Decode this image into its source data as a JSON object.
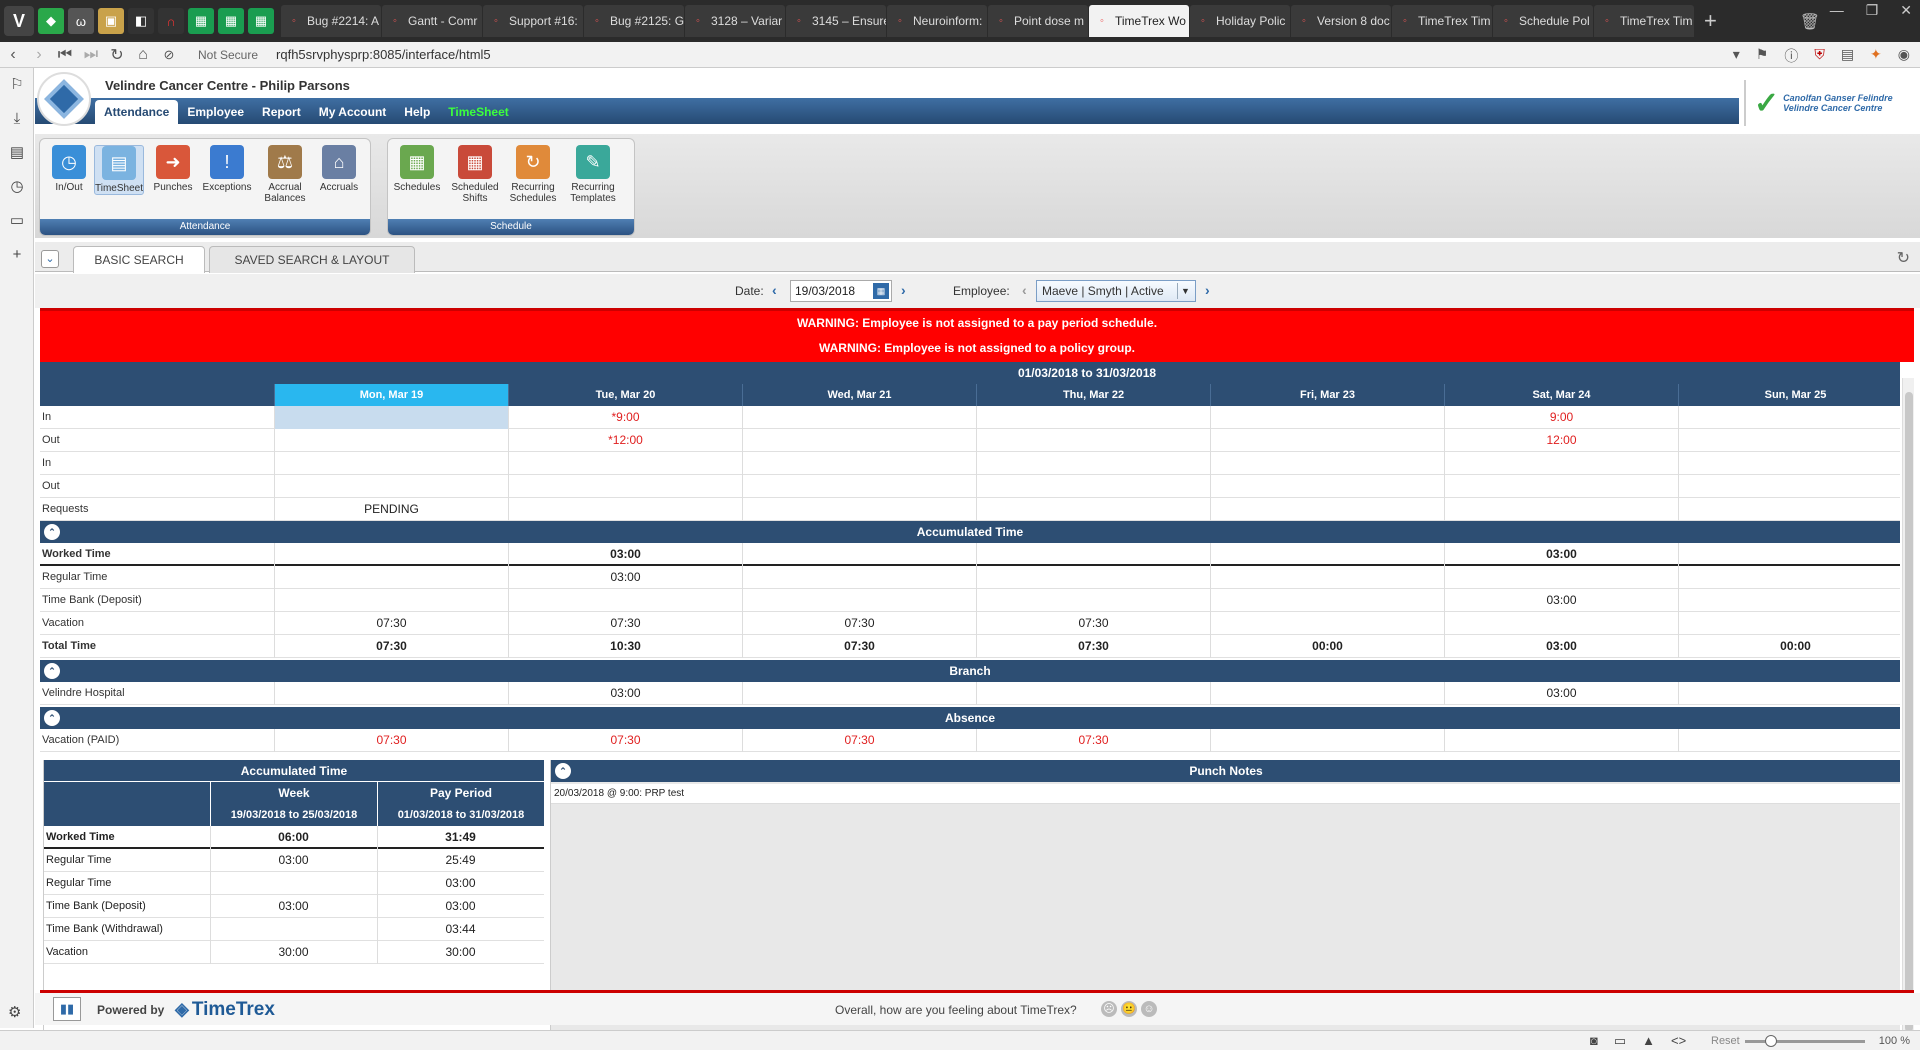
{
  "browser": {
    "tabs": [
      {
        "title": "Bug #2214: A"
      },
      {
        "title": "Gantt - Comr"
      },
      {
        "title": "Support #16:"
      },
      {
        "title": "Bug #2125: G"
      },
      {
        "title": "3128 – Variar"
      },
      {
        "title": "3145 – Ensure"
      },
      {
        "title": "Neuroinform:"
      },
      {
        "title": "Point dose m"
      },
      {
        "title": "TimeTrex Wo"
      },
      {
        "title": "Holiday Polic"
      },
      {
        "title": "Version 8 doc"
      },
      {
        "title": "TimeTrex Tim"
      },
      {
        "title": "Schedule Pol"
      },
      {
        "title": "TimeTrex Tim"
      }
    ],
    "security": "Not Secure",
    "url": "rqfh5srvphysprp:8085/interface/html5",
    "zoom": "100 %",
    "reset_label": "Reset"
  },
  "app": {
    "org_title": "Velindre Cancer Centre - Philip Parsons",
    "brand_line1": "Canolfan Ganser Felindre",
    "brand_line2": "Velindre Cancer Centre",
    "menu": [
      "Attendance",
      "Employee",
      "Report",
      "My Account",
      "Help",
      "TimeSheet"
    ],
    "attendance_group": {
      "title": "Attendance",
      "buttons": [
        {
          "label": "In/Out",
          "icon": "clock-icon"
        },
        {
          "label": "TimeSheet",
          "icon": "timesheet-icon"
        },
        {
          "label": "Punches",
          "icon": "punches-icon"
        },
        {
          "label": "Exceptions",
          "icon": "exceptions-icon"
        },
        {
          "label": "Accrual Balances",
          "icon": "scales-icon"
        },
        {
          "label": "Accruals",
          "icon": "bank-icon"
        }
      ]
    },
    "schedule_group": {
      "title": "Schedule",
      "buttons": [
        {
          "label": "Schedules",
          "icon": "schedules-icon"
        },
        {
          "label": "Scheduled Shifts",
          "icon": "shifts-icon"
        },
        {
          "label": "Recurring Schedules",
          "icon": "recurring-icon"
        },
        {
          "label": "Recurring Templates",
          "icon": "template-icon"
        }
      ]
    },
    "search_tabs": [
      "BASIC SEARCH",
      "SAVED SEARCH & LAYOUT"
    ],
    "date_label": "Date:",
    "date_value": "19/03/2018",
    "employee_label": "Employee:",
    "employee_value": "Maeve | Smyth | Active",
    "warnings": [
      "WARNING: Employee is not assigned to a pay period schedule.",
      "WARNING: Employee is not assigned to a policy group."
    ],
    "period": "01/03/2018 to 31/03/2018",
    "days": [
      "Mon, Mar 19",
      "Tue, Mar 20",
      "Wed, Mar 21",
      "Thu, Mar 22",
      "Fri, Mar 23",
      "Sat, Mar 24",
      "Sun, Mar 25"
    ],
    "punch_rows": [
      {
        "label": "In",
        "cells": [
          "",
          "*9:00",
          "",
          "",
          "",
          "9:00",
          ""
        ]
      },
      {
        "label": "Out",
        "cells": [
          "",
          "*12:00",
          "",
          "",
          "",
          "12:00",
          ""
        ]
      },
      {
        "label": "In",
        "cells": [
          "",
          "",
          "",
          "",
          "",
          "",
          ""
        ]
      },
      {
        "label": "Out",
        "cells": [
          "",
          "",
          "",
          "",
          "",
          "",
          ""
        ]
      },
      {
        "label": "Requests",
        "cells": [
          "PENDING",
          "",
          "",
          "",
          "",
          "",
          ""
        ]
      }
    ],
    "accumulated_title": "Accumulated Time",
    "accumulated_rows": [
      {
        "label": "Worked Time",
        "cells": [
          "",
          "03:00",
          "",
          "",
          "",
          "03:00",
          ""
        ]
      },
      {
        "label": "Regular Time",
        "cells": [
          "",
          "03:00",
          "",
          "",
          "",
          "",
          ""
        ]
      },
      {
        "label": "Time Bank (Deposit)",
        "cells": [
          "",
          "",
          "",
          "",
          "",
          "03:00",
          ""
        ]
      },
      {
        "label": "Vacation",
        "cells": [
          "07:30",
          "07:30",
          "07:30",
          "07:30",
          "",
          "",
          ""
        ]
      },
      {
        "label": "Total Time",
        "cells": [
          "07:30",
          "10:30",
          "07:30",
          "07:30",
          "00:00",
          "03:00",
          "00:00"
        ]
      }
    ],
    "branch_title": "Branch",
    "branch_rows": [
      {
        "label": "Velindre Hospital",
        "cells": [
          "",
          "03:00",
          "",
          "",
          "",
          "03:00",
          ""
        ]
      }
    ],
    "absence_title": "Absence",
    "absence_rows": [
      {
        "label": "Vacation (PAID)",
        "cells": [
          "07:30",
          "07:30",
          "07:30",
          "07:30",
          "",
          "",
          ""
        ]
      }
    ],
    "summary": {
      "title": "Accumulated Time",
      "col_week": "Week",
      "col_period": "Pay Period",
      "week_range": "19/03/2018 to 25/03/2018",
      "period_range": "01/03/2018 to 31/03/2018",
      "rows": [
        {
          "label": "Worked Time",
          "week": "06:00",
          "period": "31:49"
        },
        {
          "label": "Regular Time",
          "week": "03:00",
          "period": "25:49"
        },
        {
          "label": "Regular Time",
          "week": "",
          "period": "03:00"
        },
        {
          "label": "Time Bank (Deposit)",
          "week": "03:00",
          "period": "03:00"
        },
        {
          "label": "Time Bank (Withdrawal)",
          "week": "",
          "period": "03:44"
        },
        {
          "label": "Vacation",
          "week": "30:00",
          "period": "30:00"
        }
      ]
    },
    "notes_title": "Punch Notes",
    "notes": [
      "20/03/2018 @ 9:00: PRP test"
    ],
    "footer": {
      "powered": "Powered by",
      "product": "TimeTrex",
      "feedback": "Overall, how are you feeling about TimeTrex?"
    },
    "colors": {
      "header_blue": "#2d4e73",
      "today_cyan": "#29b7ef",
      "warning_red": "#ff0000",
      "value_red": "#e02020",
      "menu_green": "#3cff3c"
    }
  }
}
